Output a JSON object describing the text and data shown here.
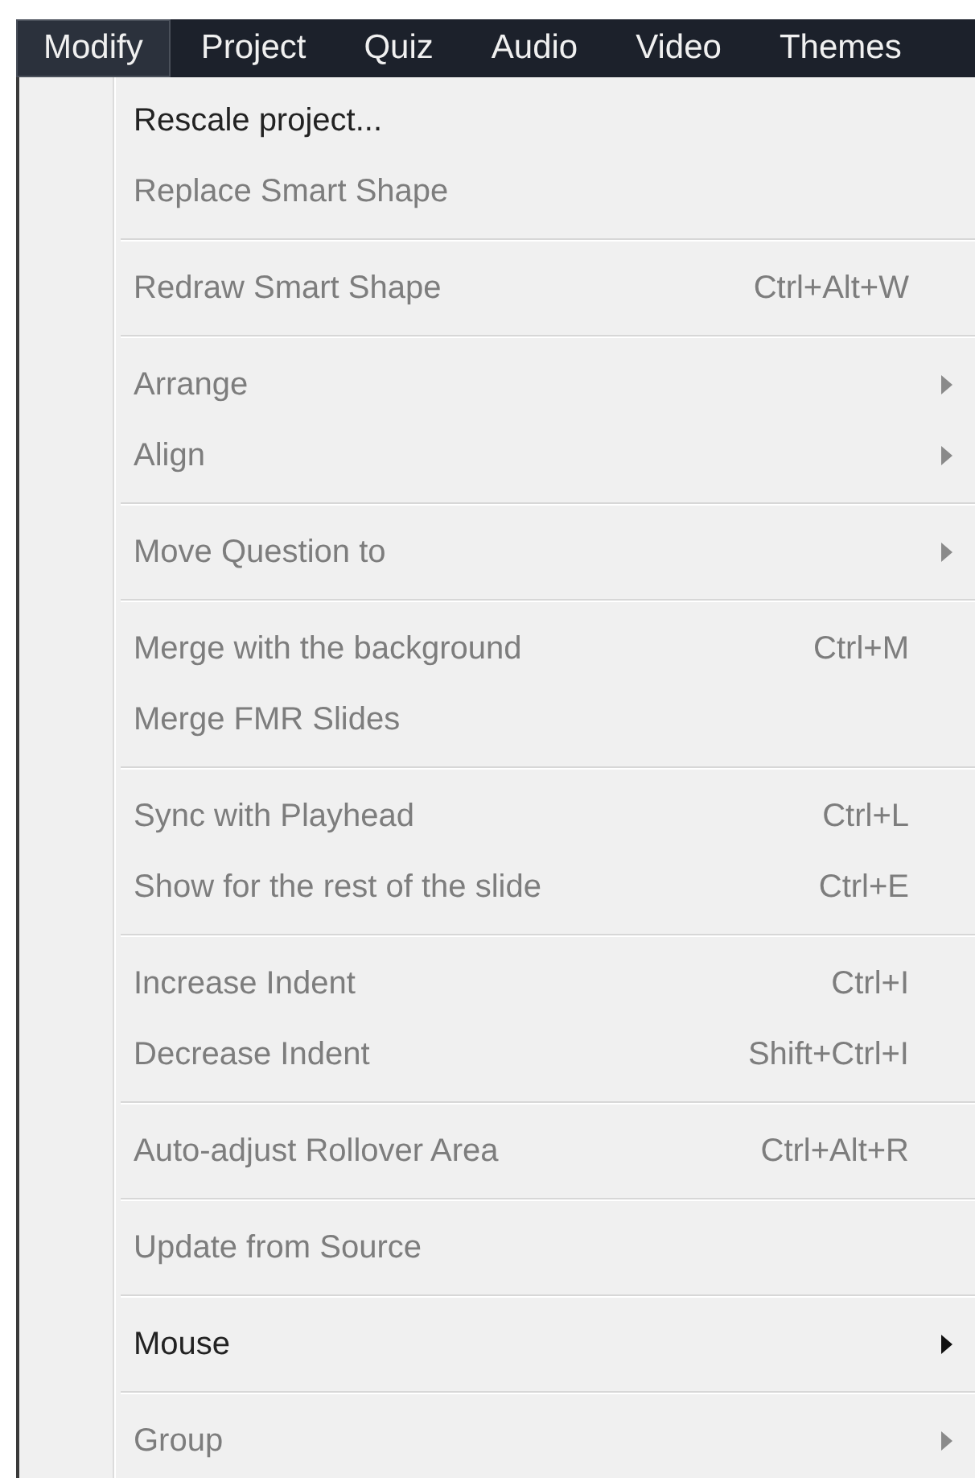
{
  "menubar": [
    {
      "label": "Modify",
      "selected": true
    },
    {
      "label": "Project",
      "selected": false
    },
    {
      "label": "Quiz",
      "selected": false
    },
    {
      "label": "Audio",
      "selected": false
    },
    {
      "label": "Video",
      "selected": false
    },
    {
      "label": "Themes",
      "selected": false
    }
  ],
  "menu": {
    "groups": [
      {
        "items": [
          {
            "label": "Rescale project...",
            "disabled": false,
            "has_submenu": false
          },
          {
            "label": "Replace Smart Shape",
            "disabled": true,
            "has_submenu": false
          }
        ]
      },
      {
        "items": [
          {
            "label": "Redraw Smart Shape",
            "shortcut": "Ctrl+Alt+W",
            "disabled": true,
            "has_submenu": false
          }
        ]
      },
      {
        "items": [
          {
            "label": "Arrange",
            "disabled": true,
            "has_submenu": true
          },
          {
            "label": "Align",
            "disabled": true,
            "has_submenu": true
          }
        ]
      },
      {
        "items": [
          {
            "label": "Move Question to",
            "disabled": true,
            "has_submenu": true
          }
        ]
      },
      {
        "items": [
          {
            "label": "Merge with the background",
            "shortcut": "Ctrl+M",
            "disabled": true,
            "has_submenu": false
          },
          {
            "label": "Merge FMR Slides",
            "disabled": true,
            "has_submenu": false
          }
        ]
      },
      {
        "items": [
          {
            "label": "Sync with Playhead",
            "shortcut": "Ctrl+L",
            "disabled": true,
            "has_submenu": false
          },
          {
            "label": "Show for the rest of the slide",
            "shortcut": "Ctrl+E",
            "disabled": true,
            "has_submenu": false
          }
        ]
      },
      {
        "items": [
          {
            "label": "Increase Indent",
            "shortcut": "Ctrl+I",
            "disabled": true,
            "has_submenu": false
          },
          {
            "label": "Decrease Indent",
            "shortcut": "Shift+Ctrl+I",
            "disabled": true,
            "has_submenu": false
          }
        ]
      },
      {
        "items": [
          {
            "label": "Auto-adjust Rollover Area",
            "shortcut": "Ctrl+Alt+R",
            "disabled": true,
            "has_submenu": false
          }
        ]
      },
      {
        "items": [
          {
            "label": "Update from Source",
            "disabled": true,
            "has_submenu": false
          }
        ]
      },
      {
        "items": [
          {
            "label": "Mouse",
            "disabled": false,
            "has_submenu": true
          }
        ]
      },
      {
        "items": [
          {
            "label": "Group",
            "disabled": true,
            "has_submenu": true
          }
        ]
      }
    ]
  }
}
